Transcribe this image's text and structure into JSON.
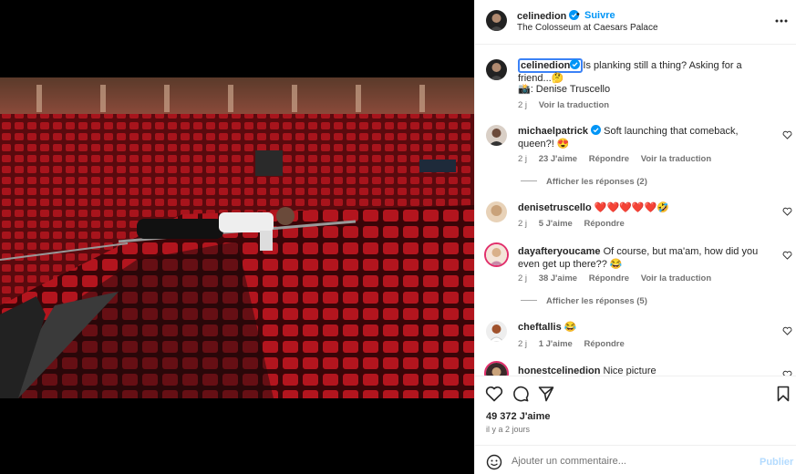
{
  "post": {
    "username": "celinedion",
    "separator": "•",
    "follow_label": "Suivre",
    "location": "The Colosseum at Caesars Palace",
    "caption_username": "celinedion",
    "caption_text": "Is planking still a thing? Asking for a friend...🤔",
    "caption_credit": "📸: Denise Truscello",
    "caption_age": "2 j",
    "caption_translate": "Voir la traduction"
  },
  "comments": [
    {
      "username": "michaelpatrick",
      "verified": true,
      "text": "Soft launching that comeback, queen?! 😍",
      "age": "2 j",
      "likes": "23 J'aime",
      "reply": "Répondre",
      "translate": "Voir la traduction",
      "replies": "Afficher les réponses (2)"
    },
    {
      "username": "denisetruscello",
      "verified": false,
      "text": "❤️❤️❤️❤️❤️🤣",
      "age": "2 j",
      "likes": "5 J'aime",
      "reply": "Répondre"
    },
    {
      "username": "dayafteryoucame",
      "verified": false,
      "text": "Of course, but ma'am, how did you even get up there?? 😂",
      "age": "2 j",
      "likes": "38 J'aime",
      "reply": "Répondre",
      "translate": "Voir la traduction",
      "replies": "Afficher les réponses (5)"
    },
    {
      "username": "cheftallis",
      "verified": false,
      "text": "😂",
      "age": "2 j",
      "likes": "1 J'aime",
      "reply": "Répondre"
    },
    {
      "username": "honestcelinedion",
      "verified": false,
      "text": "Nice picture"
    }
  ],
  "footer": {
    "likes": "49 372 J'aime",
    "posted": "il y a 2 jours",
    "comment_placeholder": "Ajouter un commentaire...",
    "publish_label": "Publier"
  },
  "icons": {
    "more": "more-horizontal-icon",
    "like": "heart-icon",
    "comment": "comment-icon",
    "share": "share-icon",
    "save": "bookmark-icon",
    "emoji": "emoji-icon",
    "verified": "verified-badge-icon"
  },
  "colors": {
    "accent": "#0095f6",
    "verified": "#0095f6",
    "text": "#262626",
    "muted": "#737373",
    "publish_disabled": "#b3dbff"
  }
}
